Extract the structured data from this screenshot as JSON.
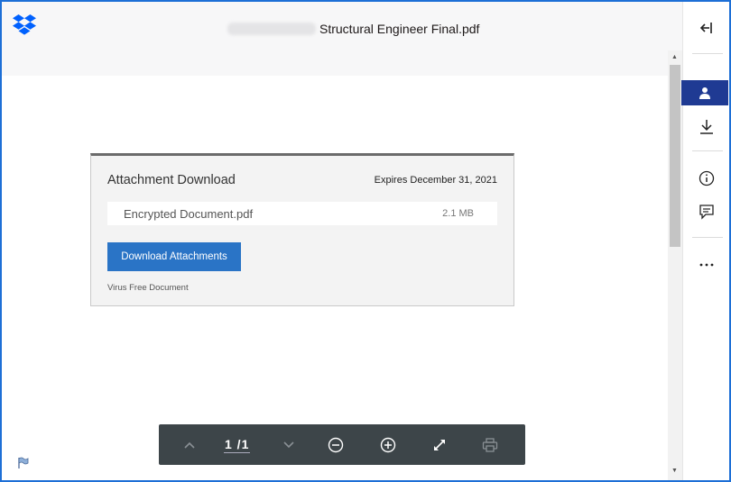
{
  "header": {
    "title": "Structural Engineer Final.pdf"
  },
  "attachment_card": {
    "title": "Attachment Download",
    "expires": "Expires December 31, 2021",
    "file_name": "Encrypted Document.pdf",
    "file_size": "2.1 MB",
    "download_button": "Download Attachments",
    "virus_note": "Virus Free Document"
  },
  "toolbar": {
    "page_indicator": "1 /1"
  },
  "colors": {
    "frame_border": "#1d6fd6",
    "brand_blue": "#0061fe",
    "active_sidebar": "#1f3a93",
    "download_button": "#2a74c6",
    "toolbar_bg": "#3d4549"
  },
  "icons": {
    "logo": "dropbox-logo",
    "sidebar": [
      "collapse-arrow-icon",
      "person-icon",
      "download-icon",
      "info-icon",
      "comment-icon",
      "more-icon"
    ],
    "toolbar": [
      "chevron-up-icon",
      "chevron-down-icon",
      "zoom-out-icon",
      "zoom-in-icon",
      "fullscreen-icon",
      "print-icon"
    ],
    "footer": "flag-icon"
  }
}
